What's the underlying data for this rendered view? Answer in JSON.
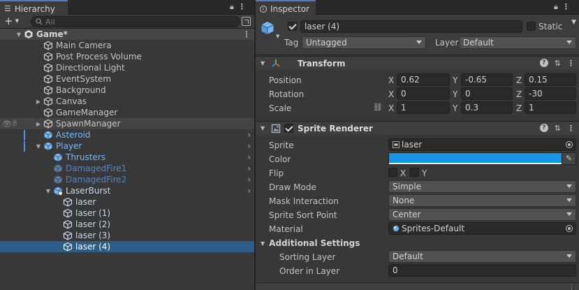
{
  "hierarchy": {
    "tab_label": "Hierarchy",
    "search_placeholder": "All",
    "scene_name": "Game*",
    "rows": [
      {
        "label": "Main Camera"
      },
      {
        "label": "Post Process Volume"
      },
      {
        "label": "Directional Light"
      },
      {
        "label": "EventSystem"
      },
      {
        "label": "Background"
      },
      {
        "label": "Canvas"
      },
      {
        "label": "GameManager"
      },
      {
        "label": "SpawnManager"
      },
      {
        "label": "Asteroid"
      },
      {
        "label": "Player"
      },
      {
        "label": "Thrusters"
      },
      {
        "label": "DamagedFire1"
      },
      {
        "label": "DamagedFire2"
      },
      {
        "label": "LaserBurst"
      },
      {
        "label": "laser"
      },
      {
        "label": "laser (1)"
      },
      {
        "label": "laser (2)"
      },
      {
        "label": "laser (3)"
      },
      {
        "label": "laser (4)"
      }
    ]
  },
  "inspector": {
    "tab_label": "Inspector",
    "object": {
      "name": "laser (4)",
      "static_label": "Static",
      "tag_label": "Tag",
      "tag_value": "Untagged",
      "layer_label": "Layer",
      "layer_value": "Default"
    },
    "transform": {
      "title": "Transform",
      "position_label": "Position",
      "rotation_label": "Rotation",
      "scale_label": "Scale",
      "position": {
        "x": "0.62",
        "y": "-0.65",
        "z": "0.15"
      },
      "rotation": {
        "x": "0",
        "y": "0",
        "z": "-30"
      },
      "scale": {
        "x": "1",
        "y": "0.3",
        "z": "1"
      },
      "axis_x": "X",
      "axis_y": "Y",
      "axis_z": "Z"
    },
    "sprite_renderer": {
      "title": "Sprite Renderer",
      "sprite_label": "Sprite",
      "sprite_value": "laser",
      "color_label": "Color",
      "color_value": "#1597e6",
      "flip_label": "Flip",
      "flip_x": "X",
      "flip_y": "Y",
      "draw_mode_label": "Draw Mode",
      "draw_mode_value": "Simple",
      "mask_label": "Mask Interaction",
      "mask_value": "None",
      "sort_point_label": "Sprite Sort Point",
      "sort_point_value": "Center",
      "material_label": "Material",
      "material_value": "Sprites-Default",
      "additional_title": "Additional Settings",
      "sorting_layer_label": "Sorting Layer",
      "sorting_layer_value": "Default",
      "order_label": "Order in Layer",
      "order_value": "0"
    }
  },
  "colors": {
    "selection": "#2c5d87",
    "prefab_text": "#7db7f2",
    "accent": "#4c7cc4"
  }
}
